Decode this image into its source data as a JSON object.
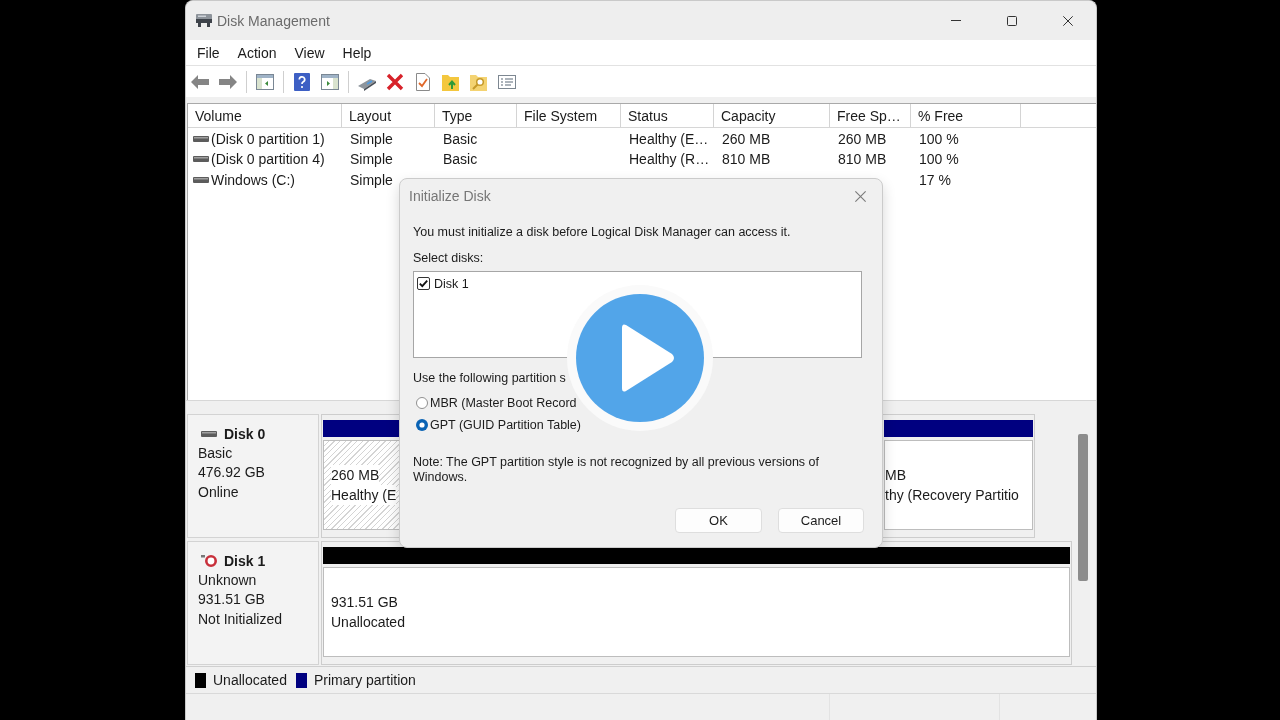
{
  "window": {
    "title": "Disk Management"
  },
  "menu": [
    "File",
    "Action",
    "View",
    "Help"
  ],
  "volume_list": {
    "columns": [
      "Volume",
      "Layout",
      "Type",
      "File System",
      "Status",
      "Capacity",
      "Free Sp…",
      "% Free"
    ],
    "rows": [
      {
        "volume": "(Disk 0 partition 1)",
        "layout": "Simple",
        "type": "Basic",
        "status": "Healthy (E…",
        "capacity": "260 MB",
        "free_space": "260 MB",
        "percent_free": "100 %"
      },
      {
        "volume": "(Disk 0 partition 4)",
        "layout": "Simple",
        "type": "Basic",
        "status": "Healthy (R…",
        "capacity": "810 MB",
        "free_space": "810 MB",
        "percent_free": "100 %"
      },
      {
        "volume": "Windows (C:)",
        "layout": "Simple",
        "percent_free": "17 %"
      }
    ]
  },
  "disks": [
    {
      "name": "Disk 0",
      "initialized": true,
      "type": "Basic",
      "size": "476.92 GB",
      "status": "Online",
      "partitions": [
        {
          "kind": "primary",
          "selected": true,
          "lines": [
            "260 MB",
            "Healthy (E"
          ]
        },
        {
          "kind": "primary",
          "selected": false,
          "lines": [
            "MB",
            "thy (Recovery Partitio"
          ]
        }
      ]
    },
    {
      "name": "Disk 1",
      "initialized": false,
      "type": "Unknown",
      "size": "931.51 GB",
      "status": "Not Initialized",
      "partitions": [
        {
          "kind": "unallocated",
          "selected": false,
          "lines": [
            "931.51 GB",
            "Unallocated"
          ]
        }
      ]
    }
  ],
  "legend": [
    {
      "label": "Unallocated",
      "color": "#000000"
    },
    {
      "label": "Primary partition",
      "color": "#000080"
    }
  ],
  "dialog": {
    "title": "Initialize Disk",
    "message": "You must initialize a disk before Logical Disk Manager can access it.",
    "select_label": "Select disks:",
    "disks": [
      {
        "label": "Disk 1",
        "checked": true
      }
    ],
    "style_label": "Use the following partition s",
    "styles": [
      {
        "label": "MBR (Master Boot Record",
        "selected": false
      },
      {
        "label": "GPT (GUID Partition Table)",
        "selected": true
      }
    ],
    "note": "Note: The GPT partition style is not recognized by all previous versions of Windows.",
    "buttons": [
      "OK",
      "Cancel"
    ]
  }
}
